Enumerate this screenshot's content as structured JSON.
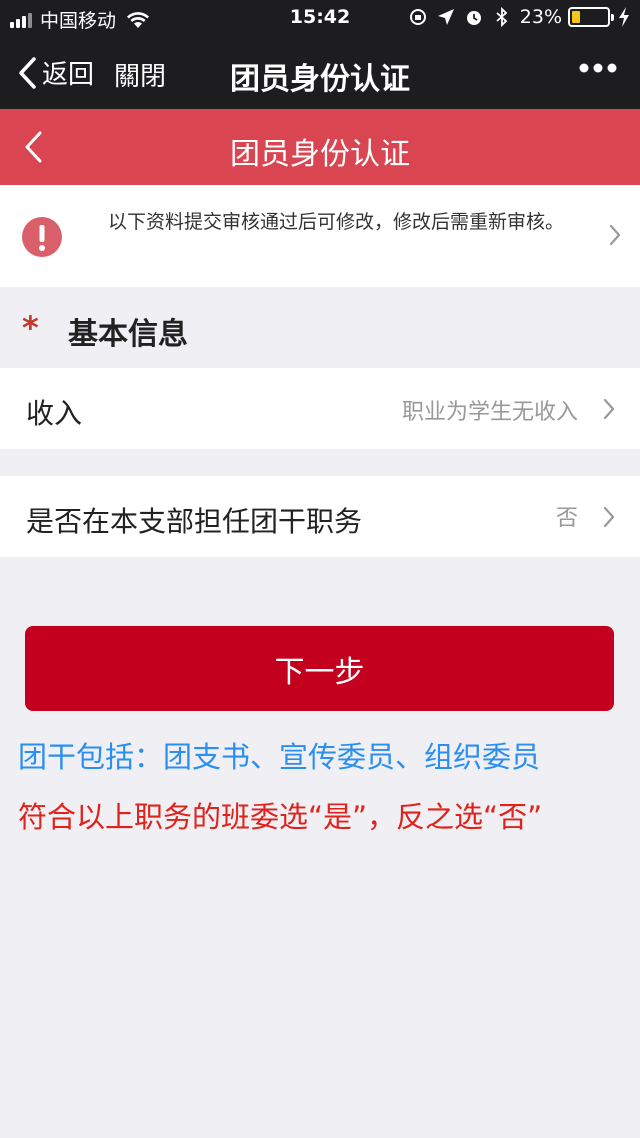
{
  "status_bar": {
    "carrier": "中国移动",
    "time": "15:42",
    "battery_percent": "23%",
    "battery_level": 0.23,
    "icons": [
      "signal-icon",
      "wifi-icon",
      "orientation-lock-icon",
      "location-icon",
      "alarm-icon",
      "bluetooth-icon",
      "battery-icon",
      "charging-icon"
    ]
  },
  "wechat_nav": {
    "back_label": "返回",
    "close_label": "關閉",
    "title": "团员身份认证"
  },
  "header": {
    "title": "团员身份认证"
  },
  "notice": {
    "text": "以下资料提交审核通过后可修改，修改后需重新审核。"
  },
  "section": {
    "required_mark": "*",
    "title": "基本信息"
  },
  "form": {
    "rows": [
      {
        "label": "收入",
        "value": "职业为学生无收入"
      },
      {
        "label": "是否在本支部担任团干职务",
        "value": "否"
      }
    ]
  },
  "next_button_label": "下一步",
  "annotations": {
    "line1": "团干包括：团支书、宣传委员、组织委员",
    "line2": "符合以上职务的班委选“是”，反之选“否”"
  },
  "colors": {
    "header_red": "#d94550",
    "button_red": "#c3001d",
    "note_blue": "#2a8ff0",
    "note_red": "#e0221b"
  }
}
